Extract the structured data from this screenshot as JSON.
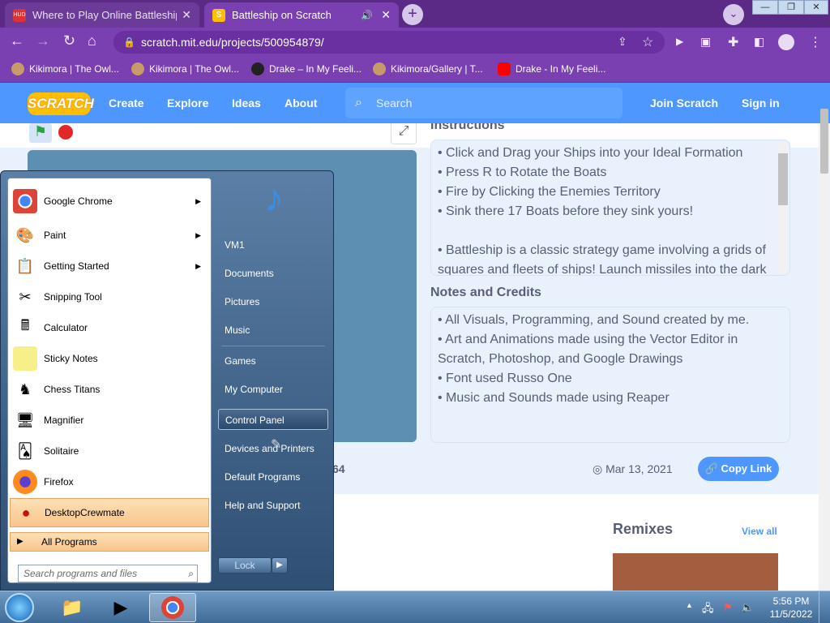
{
  "browser": {
    "tabs": [
      {
        "title": "Where to Play Online Battleship (",
        "active": false,
        "favicon_text": "HUD"
      },
      {
        "title": "Battleship on Scratch",
        "active": true,
        "favicon_text": "S"
      }
    ],
    "address": "scratch.mit.edu/projects/500954879/",
    "bookmarks": [
      {
        "label": "Kikimora | The Owl..."
      },
      {
        "label": "Kikimora | The Owl..."
      },
      {
        "label": "Drake – In My Feeli..."
      },
      {
        "label": "Kikimora/Gallery | T..."
      },
      {
        "label": "Drake - In My Feeli..."
      }
    ],
    "colors": {
      "frame": "#5b2a86",
      "toolbar": "#7a3fb0"
    }
  },
  "scratch": {
    "logo": "SCRATCH",
    "nav": [
      "Create",
      "Explore",
      "Ideas",
      "About"
    ],
    "search_placeholder": "Search",
    "join": "Join Scratch",
    "signin": "Sign in",
    "instructions_title": "Instructions",
    "instructions": [
      "• Click and Drag your Ships into your Ideal Formation",
      "• Press R to Rotate the Boats",
      "• Fire by Clicking the Enemies Territory",
      "• Sink there 17 Boats before they sink yours!",
      "",
      "• Battleship is a classic strategy game involving a grids of",
      "squares and fleets of ships! Launch missiles into the dark"
    ],
    "notes_title": "Notes and Credits",
    "notes": [
      "• All Visuals, Programming, and Sound created by me.",
      "• Art and Animations made using the Vector Editor in",
      "Scratch, Photoshop, and Google Drawings",
      "• Font used Russo One",
      "• Music and Sounds made using Reaper"
    ],
    "stat_fragment": "64",
    "date": "Mar 13, 2021",
    "copy_link": "Copy Link",
    "remixes": "Remixes",
    "view_all": "View all",
    "accent": "#4d97ff"
  },
  "startmenu": {
    "programs": [
      {
        "label": "Google Chrome",
        "has_arrow": true,
        "icon": "chrome-icon",
        "highlight": false
      },
      {
        "label": "Paint",
        "has_arrow": true,
        "icon": "paint-icon",
        "highlight": false
      },
      {
        "label": "Getting Started",
        "has_arrow": true,
        "icon": "getting-started-icon",
        "highlight": false
      },
      {
        "label": "Snipping Tool",
        "has_arrow": false,
        "icon": "scissors-icon",
        "highlight": false
      },
      {
        "label": "Calculator",
        "has_arrow": false,
        "icon": "calculator-icon",
        "highlight": false
      },
      {
        "label": "Sticky Notes",
        "has_arrow": false,
        "icon": "sticky-notes-icon",
        "highlight": false
      },
      {
        "label": "Chess Titans",
        "has_arrow": false,
        "icon": "chess-icon",
        "highlight": false
      },
      {
        "label": "Magnifier",
        "has_arrow": false,
        "icon": "magnifier-icon",
        "highlight": false
      },
      {
        "label": "Solitaire",
        "has_arrow": false,
        "icon": "cards-icon",
        "highlight": false
      },
      {
        "label": "Firefox",
        "has_arrow": false,
        "icon": "firefox-icon",
        "highlight": false
      },
      {
        "label": "DesktopCrewmate",
        "has_arrow": false,
        "icon": "crewmate-icon",
        "highlight": true
      }
    ],
    "all_programs": "All Programs",
    "search_placeholder": "Search programs and files",
    "right_items": [
      "VM1",
      "Documents",
      "Pictures",
      "Music",
      "Games",
      "My Computer",
      "Control Panel",
      "Devices and Printers",
      "Default Programs",
      "Help and Support"
    ],
    "right_highlight": "Control Panel",
    "lock": "Lock"
  },
  "taskbar": {
    "time": "5:56 PM",
    "date": "11/5/2022"
  }
}
